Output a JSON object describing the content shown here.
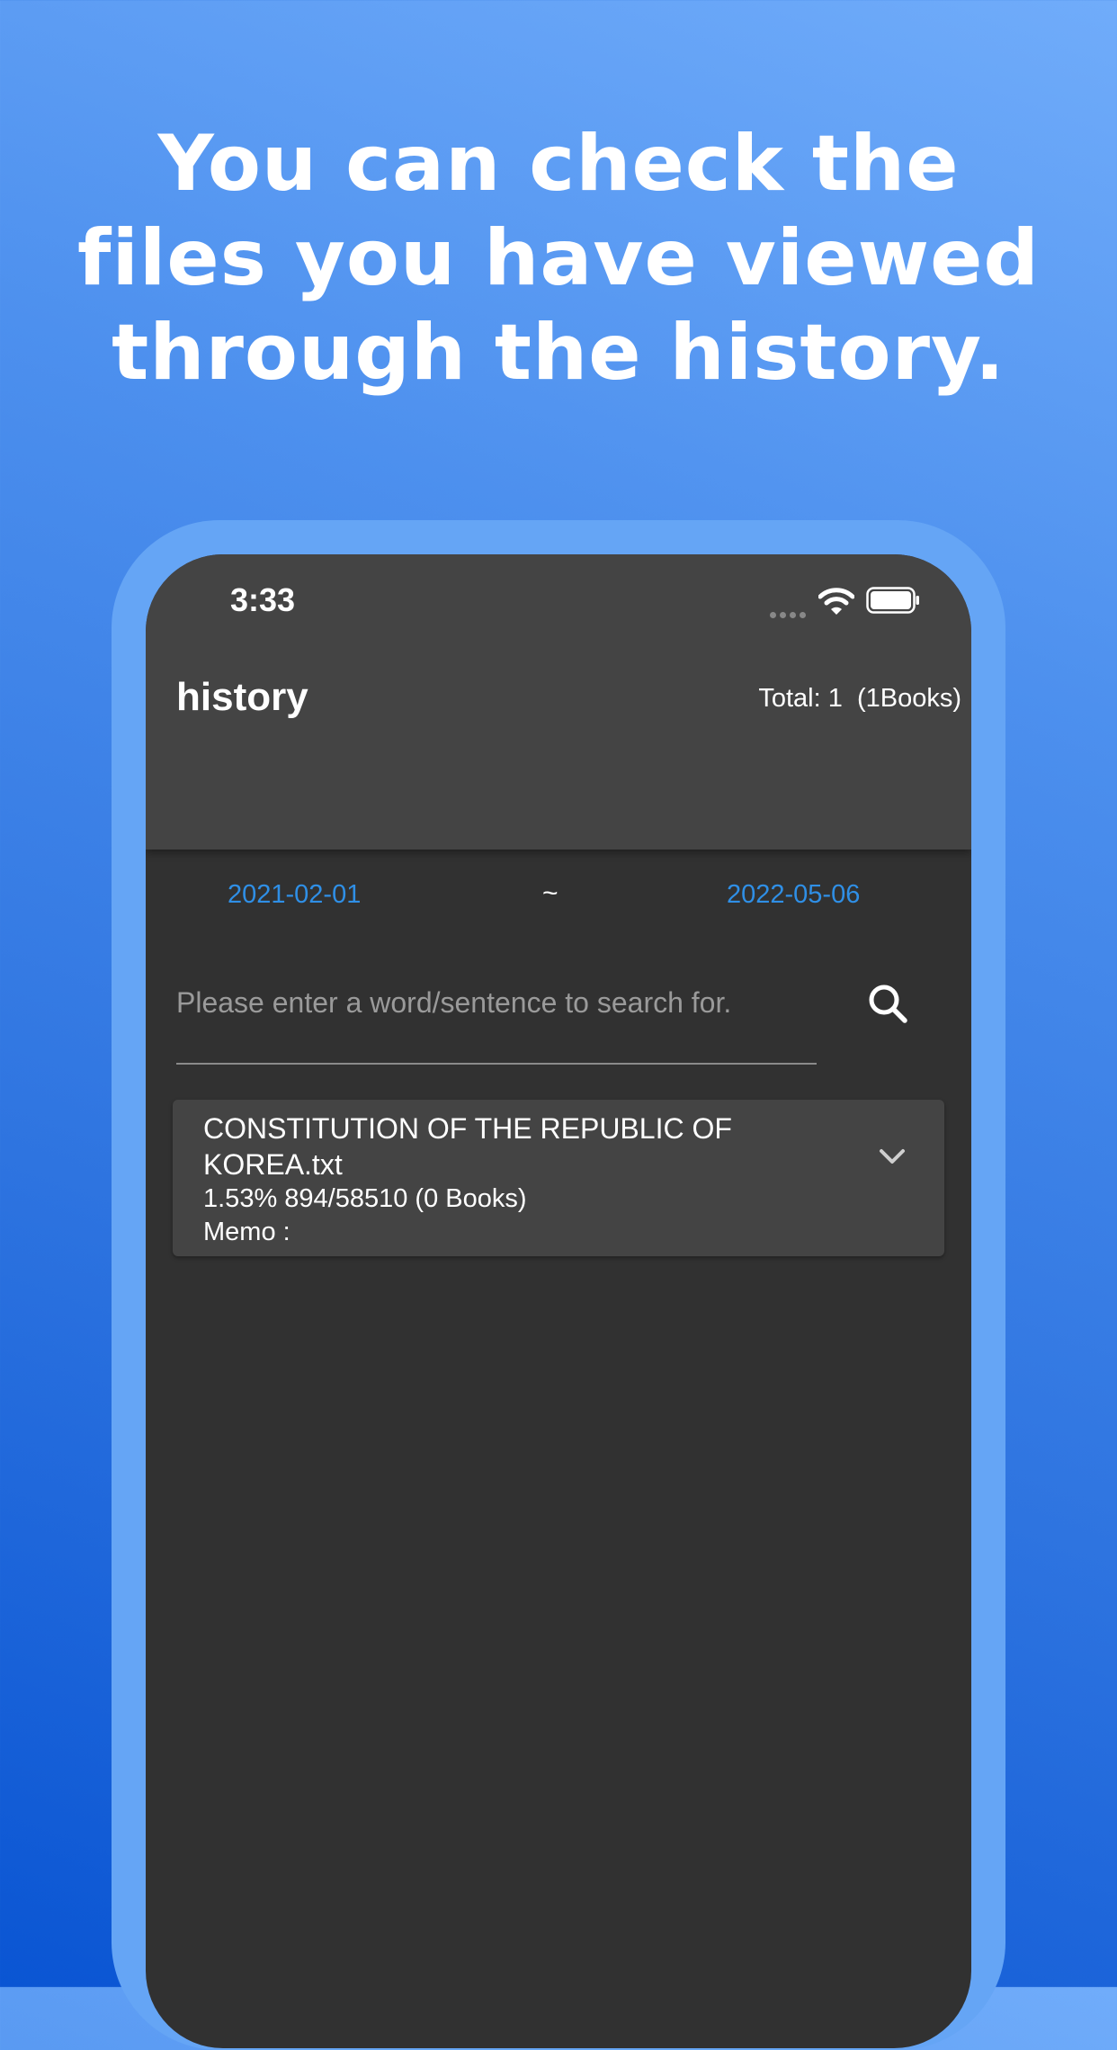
{
  "promo": {
    "line1": "You can check the",
    "line2": "files you have viewed",
    "line3": "through the history."
  },
  "status_bar": {
    "time": "3:33"
  },
  "header": {
    "title": "history",
    "total": "Total: 1  (1Books)"
  },
  "date_range": {
    "start": "2021-02-01",
    "separator": "~",
    "end": "2022-05-06"
  },
  "search": {
    "value": "",
    "placeholder": "Please enter a word/sentence to search for."
  },
  "history_items": [
    {
      "title": "CONSTITUTION OF THE REPUBLIC OF KOREA.txt",
      "progress": "1.53% 894/58510 (0 Books)",
      "memo_label": "Memo :",
      "memo": ""
    }
  ],
  "colors": {
    "accent": "#2f8fe6",
    "screen_bg": "#313131",
    "header_bg": "#444444",
    "frame": "#65a5f5"
  },
  "icons": {
    "wifi": "wifi-icon",
    "battery": "battery-icon",
    "search": "search-icon",
    "expand": "chevron-down-icon"
  }
}
